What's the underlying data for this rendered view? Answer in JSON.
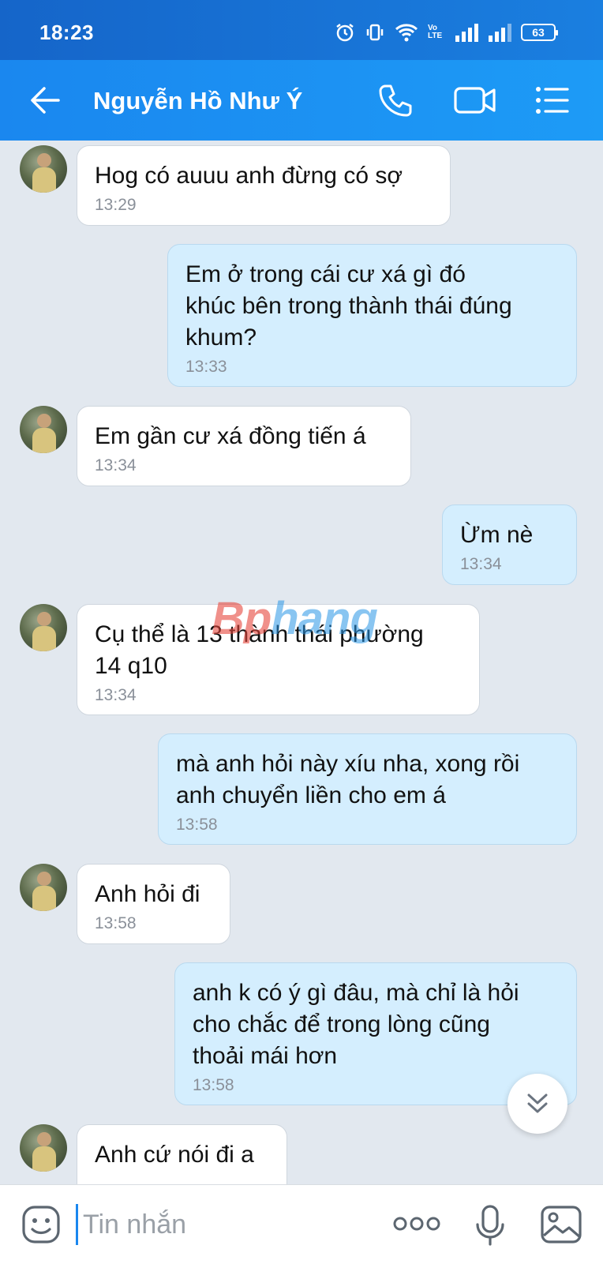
{
  "status_bar": {
    "time": "18:23",
    "battery": "63",
    "network_label": "Vo LTE"
  },
  "header": {
    "contact_name": "Nguyễn Hồ Như Ý"
  },
  "messages": [
    {
      "side": "in",
      "text": "Hog có auuu anh đừng có sợ",
      "time": "13:29"
    },
    {
      "side": "out",
      "text": "Em ở trong cái cư xá gì đó\nkhúc bên trong thành thái đúng\nkhum?",
      "time": "13:33"
    },
    {
      "side": "in",
      "text": "Em gần cư xá đồng tiến á",
      "time": "13:34"
    },
    {
      "side": "out",
      "text": "Ừm nè",
      "time": "13:34"
    },
    {
      "side": "in",
      "text": "Cụ thể là 13 thành thái phường\n14 q10",
      "time": "13:34"
    },
    {
      "side": "out",
      "text": "mà anh hỏi này xíu nha, xong rồi\nanh chuyển liền cho em á",
      "time": "13:58"
    },
    {
      "side": "in",
      "text": "Anh hỏi đi",
      "time": "13:58"
    },
    {
      "side": "out",
      "text": "anh k có ý gì đâu, mà chỉ là hỏi\ncho chắc để trong lòng cũng\nthoải mái hơn",
      "time": "13:58"
    },
    {
      "side": "in",
      "text": "Anh cứ nói đi a",
      "time": ""
    }
  ],
  "watermark": {
    "part1": "Bp",
    "part2": "hang"
  },
  "input": {
    "placeholder": "Tin nhắn"
  },
  "colors": {
    "header": "#1a87ef",
    "outgoing_bubble": "#d4eefe",
    "incoming_bubble": "#ffffff",
    "background": "#e2e8ef"
  }
}
